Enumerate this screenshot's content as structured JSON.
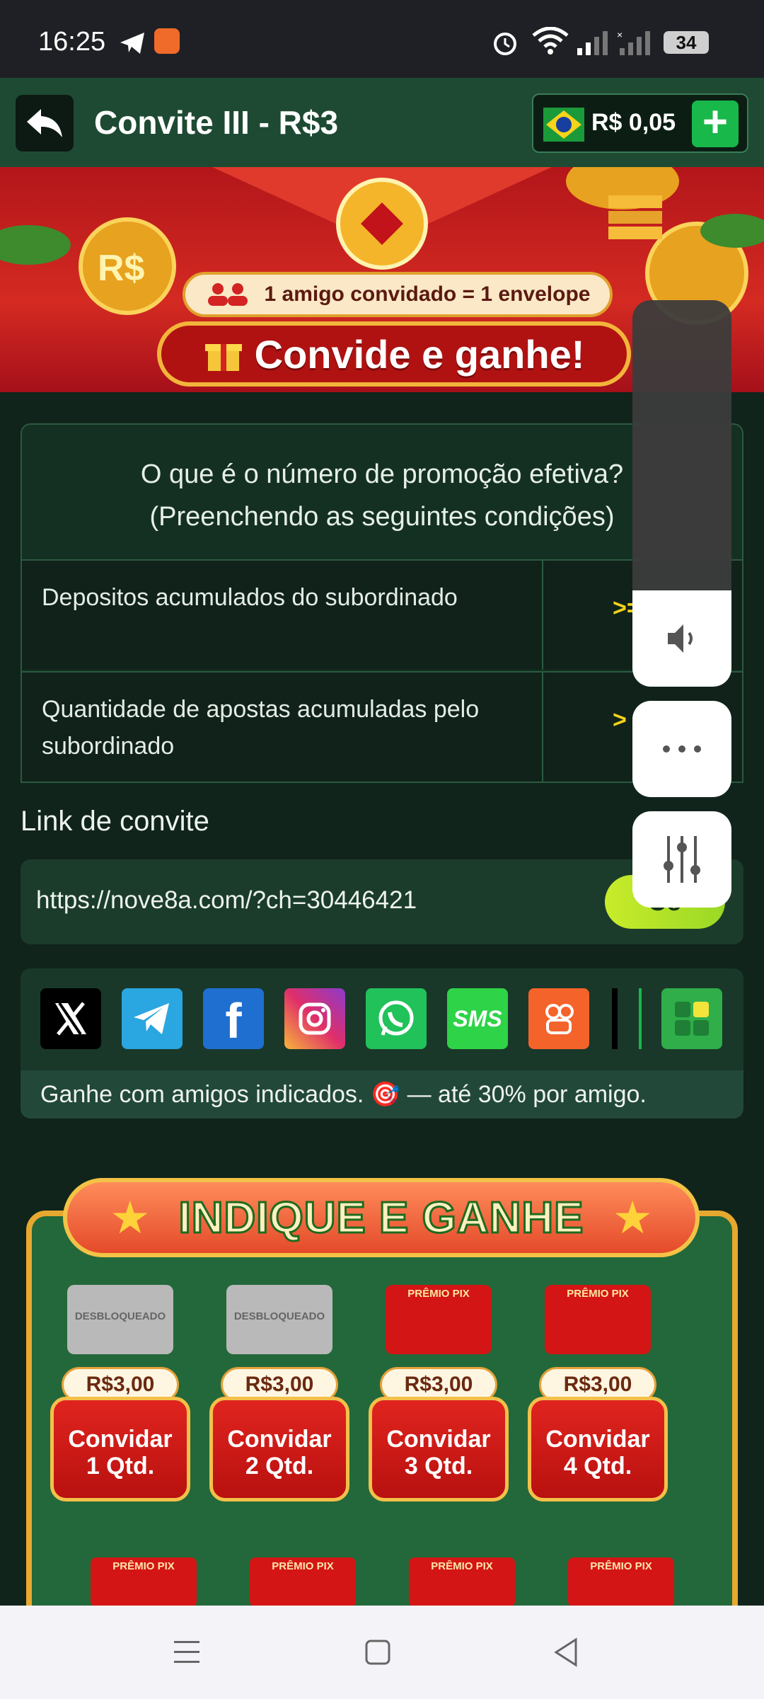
{
  "status_bar": {
    "time": "16:25",
    "battery": "34"
  },
  "header": {
    "title": "Convite III - R$3",
    "balance": "R$ 0,05",
    "add": "+"
  },
  "banner": {
    "friends_text": "1 amigo convidado = 1 envelope",
    "cta": "Convide e ganhe!"
  },
  "promo_info": {
    "question_line1": "O que é o número de promoção efetiva?",
    "question_line2": "(Preenchendo as seguintes condições)",
    "rows": [
      {
        "label": "Depositos acumulados do subordinado",
        "value": ">="
      },
      {
        "label": "Quantidade de apostas acumuladas pelo subordinado",
        "value": ">"
      }
    ]
  },
  "invite": {
    "label": "Link de convite",
    "url": "https://nove8a.com/?ch=30446421",
    "copy": "Co"
  },
  "share": {
    "icons": [
      "x-icon",
      "telegram-icon",
      "facebook-icon",
      "instagram-icon",
      "whatsapp-icon",
      "sms-icon",
      "kwai-icon",
      "more-apps-icon"
    ],
    "sms_label": "SMS",
    "note": "Ganhe com amigos indicados. 🎯 — até 30% por amigo."
  },
  "promo_board": {
    "title": "INDIQUE E GANHE",
    "envelopes": [
      {
        "amount": "R$3,00",
        "line1": "Convidar",
        "line2": "1 Qtd.",
        "state": "DESBLOQUEADO"
      },
      {
        "amount": "R$3,00",
        "line1": "Convidar",
        "line2": "2 Qtd.",
        "state": "DESBLOQUEADO"
      },
      {
        "amount": "R$3,00",
        "line1": "Convidar",
        "line2": "3 Qtd.",
        "state": "PRÊMIO PIX"
      },
      {
        "amount": "R$3,00",
        "line1": "Convidar",
        "line2": "4 Qtd.",
        "state": "PRÊMIO PIX"
      }
    ],
    "next_row_label": "PRÊMIO PIX"
  },
  "colors": {
    "header": "#1e4a33",
    "accent_green": "#19b84a",
    "yellow": "#f4d21b",
    "banner_red": "#d42a22"
  }
}
